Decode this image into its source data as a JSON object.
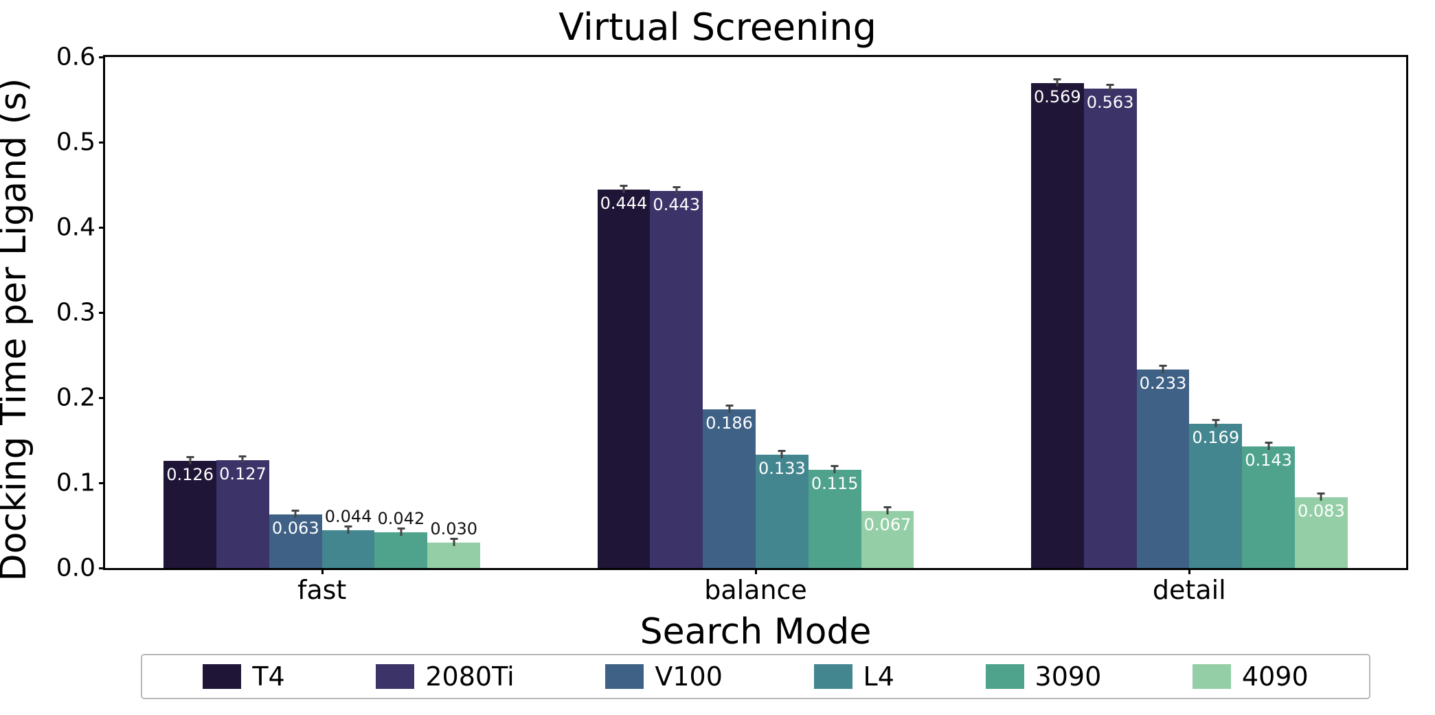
{
  "chart_data": {
    "type": "bar",
    "title": "Virtual Screening",
    "xlabel": "Search Mode",
    "ylabel": "Docking Time per Ligand (s)",
    "ylim": [
      0.0,
      0.6
    ],
    "yticks": [
      0.0,
      0.1,
      0.2,
      0.3,
      0.4,
      0.5,
      0.6
    ],
    "ytick_labels": [
      "0.0",
      "0.1",
      "0.2",
      "0.3",
      "0.4",
      "0.5",
      "0.6"
    ],
    "categories": [
      "fast",
      "balance",
      "detail"
    ],
    "series": [
      {
        "name": "T4",
        "color": "#1f1536",
        "values": [
          0.126,
          0.444,
          0.569
        ]
      },
      {
        "name": "2080Ti",
        "color": "#3c3368",
        "values": [
          0.127,
          0.443,
          0.563
        ]
      },
      {
        "name": "V100",
        "color": "#3e6185",
        "values": [
          0.063,
          0.186,
          0.233
        ]
      },
      {
        "name": "L4",
        "color": "#438690",
        "values": [
          0.044,
          0.133,
          0.169
        ]
      },
      {
        "name": "3090",
        "color": "#4fa28c",
        "values": [
          0.042,
          0.115,
          0.143
        ]
      },
      {
        "name": "4090",
        "color": "#94cea6",
        "values": [
          0.03,
          0.067,
          0.083
        ]
      }
    ],
    "value_labels": [
      [
        "0.126",
        "0.127",
        "0.063",
        "0.044",
        "0.042",
        "0.030"
      ],
      [
        "0.444",
        "0.443",
        "0.186",
        "0.133",
        "0.115",
        "0.067"
      ],
      [
        "0.569",
        "0.563",
        "0.233",
        "0.169",
        "0.143",
        "0.083"
      ]
    ],
    "error_half": 0.004,
    "label_inside_threshold": 0.05,
    "legend_position": "bottom"
  }
}
